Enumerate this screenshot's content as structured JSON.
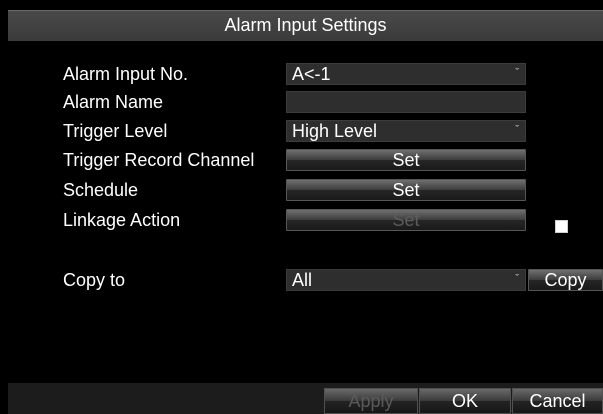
{
  "dialog": {
    "title": "Alarm Input Settings"
  },
  "form": {
    "alarm_input_no": {
      "label": "Alarm Input No.",
      "value": "A<-1"
    },
    "alarm_name": {
      "label": "Alarm Name",
      "value": ""
    },
    "trigger_level": {
      "label": "Trigger Level",
      "value": "High Level"
    },
    "trigger_record_channel": {
      "label": "Trigger Record Channel",
      "button": "Set"
    },
    "schedule": {
      "label": "Schedule",
      "button": "Set"
    },
    "linkage_action": {
      "label": "Linkage Action",
      "button": "Set",
      "enabled": false
    },
    "copy_to": {
      "label": "Copy to",
      "value": "All",
      "button": "Copy"
    }
  },
  "footer": {
    "apply": "Apply",
    "ok": "OK",
    "cancel": "Cancel"
  },
  "icons": {
    "dropdown": "chevron-down-icon",
    "chevron_glyph": "ˇ"
  }
}
